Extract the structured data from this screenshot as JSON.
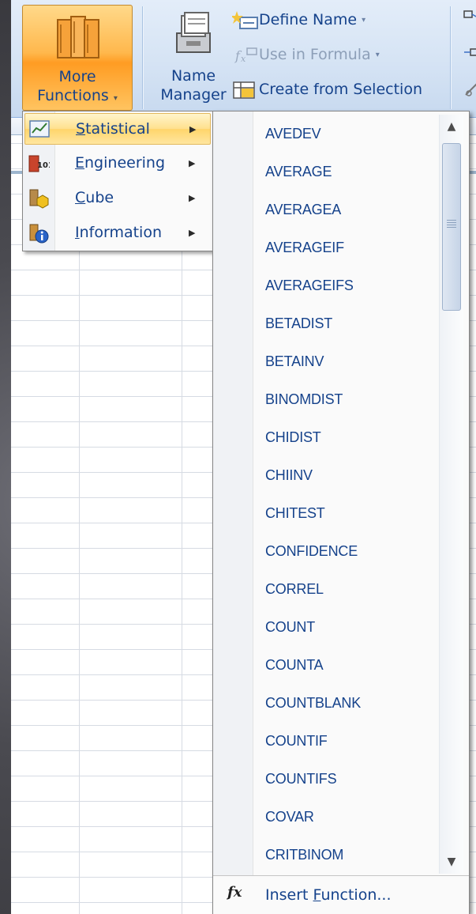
{
  "ribbon": {
    "more_functions": {
      "line1": "More",
      "line2": "Functions",
      "arrow": "▾",
      "icon": "books-icon"
    },
    "name_manager": {
      "line1": "Name",
      "line2": "Manager",
      "icon": "name-manager-icon"
    },
    "define_name": {
      "label": "Define Name",
      "arrow": "▾",
      "icon": "define-name-icon"
    },
    "use_in_formula": {
      "label": "Use in Formula",
      "arrow": "▾",
      "icon": "fx-formula-icon"
    },
    "create_from_selection": {
      "label": "Create from Selection",
      "icon": "create-from-selection-icon"
    }
  },
  "category_menu": {
    "items": [
      {
        "prefix": "",
        "key": "S",
        "rest": "tatistical",
        "icon": "statistical-chart-icon",
        "active": true
      },
      {
        "prefix": "",
        "key": "E",
        "rest": "ngineering",
        "icon": "engineering-101-icon",
        "active": false
      },
      {
        "prefix": "",
        "key": "C",
        "rest": "ube",
        "icon": "cube-icon",
        "active": false
      },
      {
        "prefix": "",
        "key": "I",
        "rest": "nformation",
        "icon": "information-icon",
        "active": false
      }
    ],
    "chevron": "▶"
  },
  "function_list": {
    "items": [
      "AVEDEV",
      "AVERAGE",
      "AVERAGEA",
      "AVERAGEIF",
      "AVERAGEIFS",
      "BETADIST",
      "BETAINV",
      "BINOMDIST",
      "CHIDIST",
      "CHIINV",
      "CHITEST",
      "CONFIDENCE",
      "CORREL",
      "COUNT",
      "COUNTA",
      "COUNTBLANK",
      "COUNTIF",
      "COUNTIFS",
      "COVAR",
      "CRITBINOM"
    ],
    "scroll_up": "▲",
    "scroll_down": "▼",
    "footer": {
      "fx": "fx",
      "label_pre": "Insert ",
      "label_key": "F",
      "label_post": "unction..."
    }
  }
}
